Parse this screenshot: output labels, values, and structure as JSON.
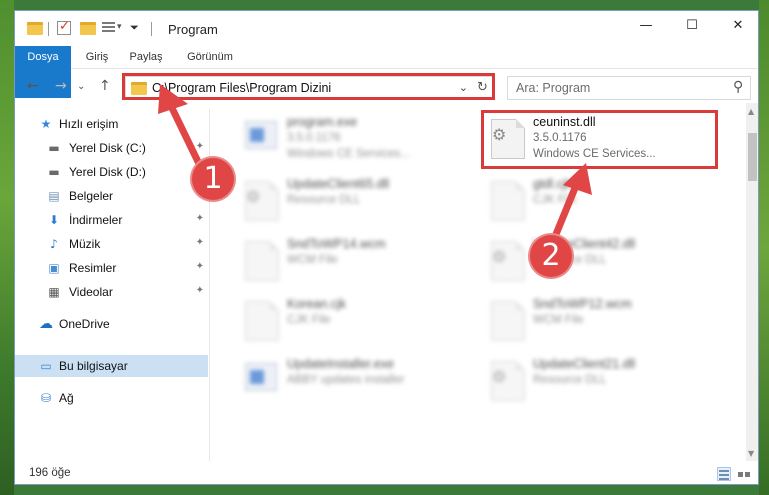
{
  "window": {
    "title": "Program",
    "minimize_glyph": "—",
    "maximize_glyph": "☐",
    "close_glyph": "✕"
  },
  "ribbon": {
    "tabs": [
      {
        "label": "Dosya"
      },
      {
        "label": "Giriş"
      },
      {
        "label": "Paylaş"
      },
      {
        "label": "Görünüm"
      }
    ]
  },
  "address": {
    "path": "C:\\Program Files\\Program Dizini",
    "dropdown_glyph": "⌄",
    "refresh_glyph": "↻"
  },
  "search": {
    "placeholder": "Ara: Program",
    "icon_glyph": "⚲"
  },
  "nav_glyphs": {
    "back": "←",
    "forward": "→",
    "recent": "⌄",
    "up": "↑"
  },
  "sidebar": {
    "items": [
      {
        "label": "Hızlı erişim",
        "icon": "star-icon",
        "glyph": "★",
        "color": "#3a86d6"
      },
      {
        "label": "Yerel Disk (C:)",
        "icon": "drive-icon",
        "glyph": "▬",
        "color": "#6a6a6a"
      },
      {
        "label": "Yerel Disk (D:)",
        "icon": "drive-icon",
        "glyph": "▬",
        "color": "#6a6a6a"
      },
      {
        "label": "Belgeler",
        "icon": "documents-icon",
        "glyph": "▤",
        "color": "#6f8fb3"
      },
      {
        "label": "İndirmeler",
        "icon": "download-icon",
        "glyph": "⬇",
        "color": "#2b7bd0"
      },
      {
        "label": "Müzik",
        "icon": "music-icon",
        "glyph": "♪",
        "color": "#2b7bd0"
      },
      {
        "label": "Resimler",
        "icon": "pictures-icon",
        "glyph": "▣",
        "color": "#4a8ad1"
      },
      {
        "label": "Videolar",
        "icon": "video-icon",
        "glyph": "▦",
        "color": "#555555"
      },
      {
        "label": "OneDrive",
        "icon": "cloud-icon",
        "glyph": "☁",
        "color": "#1f6fc4"
      },
      {
        "label": "Bu bilgisayar",
        "icon": "computer-icon",
        "glyph": "▭",
        "color": "#3a86d6"
      },
      {
        "label": "Ağ",
        "icon": "network-icon",
        "glyph": "⛁",
        "color": "#3a86d6"
      }
    ],
    "pin_glyph": "✦"
  },
  "files": [
    {
      "name": "program.exe",
      "version": "3.5.0.1176",
      "desc": "Windows CE Services...",
      "icon": "exe-icon"
    },
    {
      "name": "ceuninst.dll",
      "version": "3.5.0.1176",
      "desc": "Windows CE Services...",
      "icon": "dll-icon"
    },
    {
      "name": "UpdateClient65.dll",
      "version": "Resource DLL",
      "desc": "",
      "icon": "dll-icon"
    },
    {
      "name": "gtdl.cjk",
      "version": "CJK File",
      "desc": "",
      "icon": "file-icon"
    },
    {
      "name": "SndToWP14.wcm",
      "version": "WCM File",
      "desc": "",
      "icon": "file-icon"
    },
    {
      "name": "UpdateClient42.dll",
      "version": "Resource DLL",
      "desc": "",
      "icon": "dll-icon"
    },
    {
      "name": "Korean.cjk",
      "version": "CJK File",
      "desc": "",
      "icon": "file-icon"
    },
    {
      "name": "SndToWP12.wcm",
      "version": "WCM File",
      "desc": "",
      "icon": "file-icon"
    },
    {
      "name": "UpdateInstaller.exe",
      "version": "ABBY updates installer",
      "desc": "",
      "icon": "exe-icon"
    },
    {
      "name": "UpdateClient21.dll",
      "version": "Resource DLL",
      "desc": "",
      "icon": "dll-icon"
    }
  ],
  "gear_glyph": "⚙",
  "status": {
    "count": "196 öğe"
  },
  "annotations": {
    "callout_1": "1",
    "callout_2": "2",
    "color": "#d93b3b"
  }
}
